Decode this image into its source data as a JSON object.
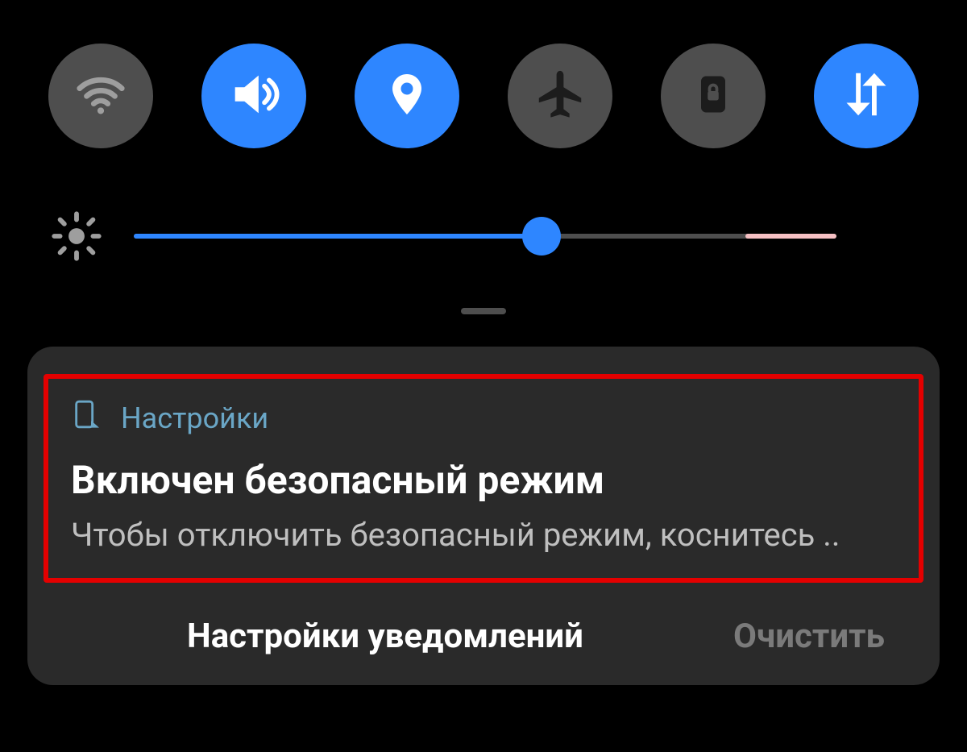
{
  "quick_settings": {
    "wifi": {
      "icon": "wifi-icon",
      "active": false
    },
    "sound": {
      "icon": "volume-icon",
      "active": true
    },
    "location": {
      "icon": "location-icon",
      "active": true
    },
    "airplane": {
      "icon": "airplane-icon",
      "active": false
    },
    "rotation": {
      "icon": "rotation-lock-icon",
      "active": false
    },
    "data": {
      "icon": "data-icon",
      "active": true
    }
  },
  "brightness": {
    "value_percent": 58,
    "overbright_start_percent": 87
  },
  "notification": {
    "source": "Настройки",
    "title": "Включен безопасный режим",
    "body": "Чтобы отключить безопасный режим, коснитесь ..",
    "highlighted": true,
    "highlight_color": "#e40000"
  },
  "actions": {
    "settings_label": "Настройки уведомлений",
    "clear_label": "Очистить",
    "clear_enabled": false
  },
  "colors": {
    "accent": "#2e86ff",
    "toggle_off": "#4e4e4e",
    "card_bg": "#2a2a2a",
    "overbright": "#f6c0c3"
  }
}
